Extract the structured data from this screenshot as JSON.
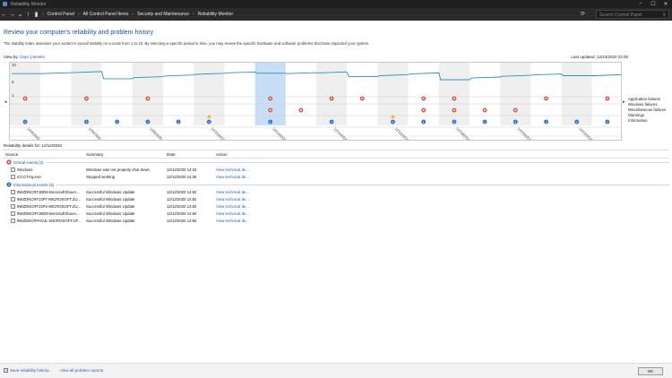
{
  "window": {
    "title": "Reliability Monitor"
  },
  "address": {
    "crumbs": [
      "Control Panel",
      "All Control Panel Items",
      "Security and Maintenance",
      "Reliability Monitor"
    ],
    "search_placeholder": "Search Control Panel"
  },
  "page": {
    "heading": "Review your computer's reliability and problem history",
    "description": "The stability index assesses your system's overall stability on a scale from 1 to 10. By selecting a specific period in time, you may review the specific hardware and software problems that have impacted your system.",
    "view_by_label": "View by:",
    "view_days": "Days",
    "view_sep": "|",
    "view_weeks": "Weeks",
    "last_updated": "Last updated: 12/23/2020 22:00"
  },
  "chart_data": {
    "type": "line",
    "title": "",
    "y_ticks": [
      "10",
      "5",
      "1"
    ],
    "ylim": [
      1,
      10
    ],
    "categories": [
      "12/4/2020",
      "12/5/2020",
      "12/6/2020",
      "12/7/2020",
      "12/8/2020",
      "12/9/2020",
      "12/10/2020",
      "12/11/2020",
      "12/12/2020",
      "12/13/2020",
      "12/14/2020",
      "12/15/2020",
      "12/16/2020",
      "12/17/2020",
      "12/18/2020",
      "12/19/2020",
      "12/20/2020",
      "12/21/2020",
      "12/22/2020",
      "12/23/2020"
    ],
    "date_labels": [
      "12/4/2020",
      "12/6/2020",
      "12/8/2020",
      "12/10/2020",
      "12/12/2020",
      "12/14/2020",
      "12/16/2020",
      "12/18/2020",
      "12/20/2020",
      "12/22/2020"
    ],
    "series": [
      {
        "values": [
          7.3,
          7.6,
          7.9,
          5.8,
          6.4,
          6.9,
          7.4,
          7.8,
          7.4,
          7.6,
          7.8,
          6.4,
          7.0,
          7.5,
          5.5,
          6.3,
          6.8,
          7.2,
          6.7,
          7.0
        ]
      }
    ],
    "selected_index": 8,
    "legend_rows": [
      "Application failures",
      "Windows failures",
      "Miscellaneous failures",
      "Warnings",
      "Information"
    ],
    "events": {
      "application_failures": [
        0,
        2,
        4,
        8,
        10,
        11,
        13,
        14,
        17,
        19
      ],
      "misc_failures": [
        8,
        9,
        13,
        14,
        15,
        16
      ],
      "warnings": [
        6,
        12
      ],
      "information": [
        0,
        2,
        3,
        4,
        5,
        6,
        8,
        10,
        12,
        13,
        14,
        15,
        16,
        17,
        18,
        19
      ]
    }
  },
  "details": {
    "label": "Reliability details for: 12/12/2020",
    "columns": {
      "source": "Source",
      "summary": "Summary",
      "date": "Date",
      "action": "Action"
    },
    "critical_group": "Critical events (2)",
    "critical": [
      {
        "source": "Windows",
        "summary": "Windows was not properly shut down",
        "date": "12/12/2020 14:33",
        "action": "View technical de..."
      },
      {
        "source": "ICCCTray.exe",
        "summary": "Stopped working",
        "date": "12/12/2020 14:36",
        "action": "View technical de..."
      }
    ],
    "info_group": "Informational events (5)",
    "info": [
      {
        "source": "9WZDNCRFJBD8-MicrosoftXboxA...",
        "summary": "Successful Windows Update",
        "date": "12/12/2020 14:50",
        "action": "View technical de..."
      },
      {
        "source": "9WZDNCRFJ3PT-MICROSOFT.ZU...",
        "summary": "Successful Windows Update",
        "date": "12/12/2020 14:50",
        "action": "View technical de..."
      },
      {
        "source": "9WZDNCRFJ3P2-MICROSOFT.ZU...",
        "summary": "Successful Windows Update",
        "date": "12/12/2020 14:50",
        "action": "View technical de..."
      },
      {
        "source": "9WZDNCRFJBD8-MicrosoftXboxA...",
        "summary": "Successful Windows Update",
        "date": "12/12/2020 14:50",
        "action": "View technical de..."
      },
      {
        "source": "9WZDNCRFHVJL-MICROSOFT.OF...",
        "summary": "Successful Windows Update",
        "date": "12/12/2020 14:50",
        "action": "View technical de..."
      }
    ]
  },
  "footer": {
    "save_link": "Save reliability history...",
    "problems_link": "View all problem reports",
    "ok_label": "OK"
  }
}
